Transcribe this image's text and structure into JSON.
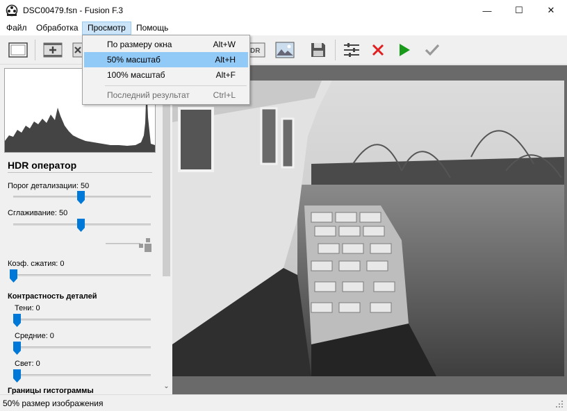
{
  "window": {
    "title": "DSC00479.fsn - Fusion F.3",
    "minimize": "—",
    "maximize": "☐",
    "close": "✕"
  },
  "menu": [
    "Файл",
    "Обработка",
    "Просмотр",
    "Помощь"
  ],
  "dropdown": {
    "items": [
      {
        "label": "По размеру окна",
        "shortcut": "Alt+W"
      },
      {
        "label": "50% масштаб",
        "shortcut": "Alt+H"
      },
      {
        "label": "100% масштаб",
        "shortcut": "Alt+F"
      },
      {
        "label": "Последний результат",
        "shortcut": "Ctrl+L"
      }
    ]
  },
  "toolbar": {
    "buttons": [
      "frame-icon",
      "add-frame-icon",
      "remove-frame-icon",
      "hdr-icon",
      "landscape-icon",
      "save-icon",
      "settings-sliders-icon",
      "cancel-icon",
      "run-icon",
      "apply-icon"
    ],
    "hdr_text": "DR"
  },
  "panel": {
    "hdr_title": "HDR оператор",
    "detail_threshold": {
      "label": "Порог детализации: 50",
      "value": 50
    },
    "smoothing": {
      "label": "Сглаживание: 50",
      "value": 50
    },
    "compression": {
      "label": "Коэф. сжатия: 0",
      "value": 0
    },
    "detail_contrast_title": "Контрастность деталей",
    "shadows": {
      "label": "Тени: 0",
      "value": 0
    },
    "midtones": {
      "label": "Средние: 0",
      "value": 0
    },
    "highlights": {
      "label": "Свет: 0",
      "value": 0
    },
    "histogram_bounds_title": "Границы гистограммы"
  },
  "status": {
    "text": "50% размер изображения"
  },
  "colors": {
    "menu_active": "#cce4f7",
    "dropdown_highlight": "#91c9f7",
    "slider_thumb": "#0078d7",
    "cancel": "#e02020",
    "run": "#1a9a1a"
  }
}
